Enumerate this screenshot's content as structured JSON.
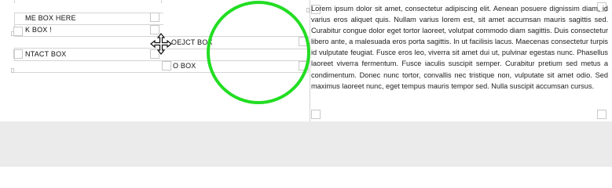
{
  "boxes": [
    {
      "label": "ME BOX HERE"
    },
    {
      "label": "K BOX !"
    },
    {
      "label": "NTACT BOX"
    },
    {
      "label": "OEJCT BOX"
    },
    {
      "label": "O BOX"
    }
  ],
  "paragraph": {
    "text": "Lorem ipsum dolor sit amet, consectetur adipiscing elit. Aenean posuere dignissim diam, id varius eros aliquet quis. Nullam varius lorem est, sit amet accumsan mauris sagittis sed. Curabitur congue dolor eget tortor laoreet, volutpat commodo diam sagittis. Duis consectetur libero ante, a malesuada eros porta sagittis. In ut facilisis lacus. Maecenas consectetur turpis id vulputate feugiat. Fusce eros leo, viverra sit amet dui ut, pulvinar egestas nunc. Phasellus laoreet viverra fermentum. Fusce iaculis suscipit semper. Curabitur pretium sed metus a condimentum. Donec nunc tortor, convallis nec tristique non, vulputate sit amet odio. Sed maximus laoreet nunc, eget tempus mauris tempor sed. Nulla suscipit accumsan cursus."
  },
  "colors": {
    "highlight_ring": "#22dd22",
    "gray_area": "#ebebeb",
    "guide_line": "#d4d4d4"
  },
  "icons": {
    "move_cursor": "move-arrows-icon"
  }
}
